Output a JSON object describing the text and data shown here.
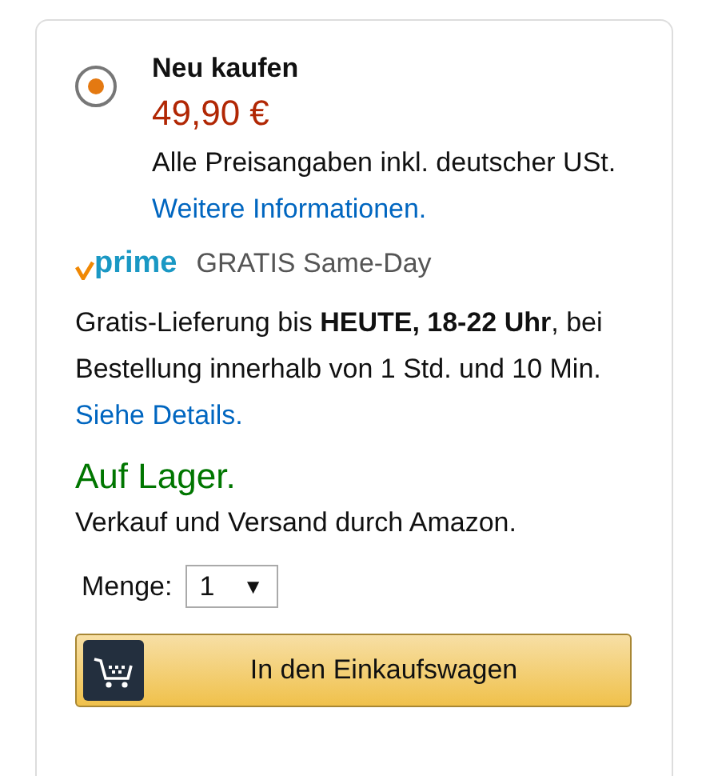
{
  "offer": {
    "selected": true,
    "title": "Neu kaufen",
    "price": "49,90 €",
    "tax_note": "Alle Preisangaben inkl. deutscher USt.",
    "tax_link": "Weitere Informationen."
  },
  "prime": {
    "logo": "prime",
    "label": "GRATIS Same-Day"
  },
  "delivery": {
    "text": "Gratis-Lieferung bis **HEUTE, 18-22 Uhr**, bei Bestellung innerhalb von 1 Std. und 10 Min.",
    "link": "Siehe Details."
  },
  "availability": "Auf Lager.",
  "seller": "Verkauf und Versand durch Amazon.",
  "quantity": {
    "label": "Menge:",
    "value": "1",
    "arrow": "▼"
  },
  "cart_button": "In den Einkaufswagen"
}
